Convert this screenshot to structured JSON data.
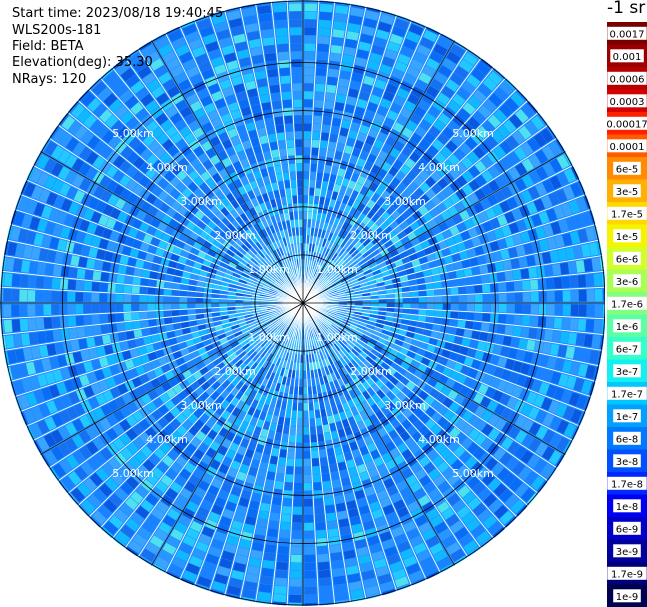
{
  "header": {
    "start_time": "Start time: 2023/08/18 19:40:45",
    "instrument": "WLS200s-181",
    "field": "Field: BETA",
    "elevation": "Elevation(deg): 35.30",
    "nrays": "NRays: 120"
  },
  "chart_data": {
    "type": "heatmap",
    "projection": "polar-ppi",
    "field": "BETA",
    "units": "-1 sr",
    "n_rays": 120,
    "range_rings_km": [
      1.0,
      2.0,
      3.0,
      4.0,
      5.0
    ],
    "range_ring_labels": [
      "1.00km",
      "2.00km",
      "3.00km",
      "4.00km",
      "5.00km"
    ],
    "max_range_km": 6.3,
    "spoke_angles_deg": [
      0,
      30,
      60,
      90,
      120,
      150,
      180,
      210,
      240,
      270,
      300,
      330
    ],
    "dominant_value_range": [
      "6e-9",
      "6e-8"
    ],
    "colorbar": {
      "title": "-1 sr",
      "tick_labels": [
        "0.0017",
        "0.001",
        "0.0006",
        "0.0003",
        "0.00017",
        "0.0001",
        "6e-5",
        "3e-5",
        "1.7e-5",
        "1e-5",
        "6e-6",
        "3e-6",
        "1.7e-6",
        "1e-6",
        "6e-7",
        "3e-7",
        "1.7e-7",
        "1e-7",
        "6e-8",
        "3e-8",
        "1.7e-8",
        "1e-8",
        "6e-9",
        "3e-9",
        "1.7e-9",
        "1e-9"
      ],
      "colors": [
        "#7a0000",
        "#9a0000",
        "#b80000",
        "#d40000",
        "#ff2000",
        "#ff5a00",
        "#ff8c00",
        "#ffb000",
        "#ffd800",
        "#f4f400",
        "#d2ff2c",
        "#aaff55",
        "#82ff7e",
        "#5cffa6",
        "#36ffcc",
        "#14f0f0",
        "#00c8ff",
        "#00a0ff",
        "#0078ff",
        "#0050ff",
        "#0028ff",
        "#0000f0",
        "#0000c8",
        "#00009c",
        "#000078",
        "#000050"
      ]
    }
  }
}
